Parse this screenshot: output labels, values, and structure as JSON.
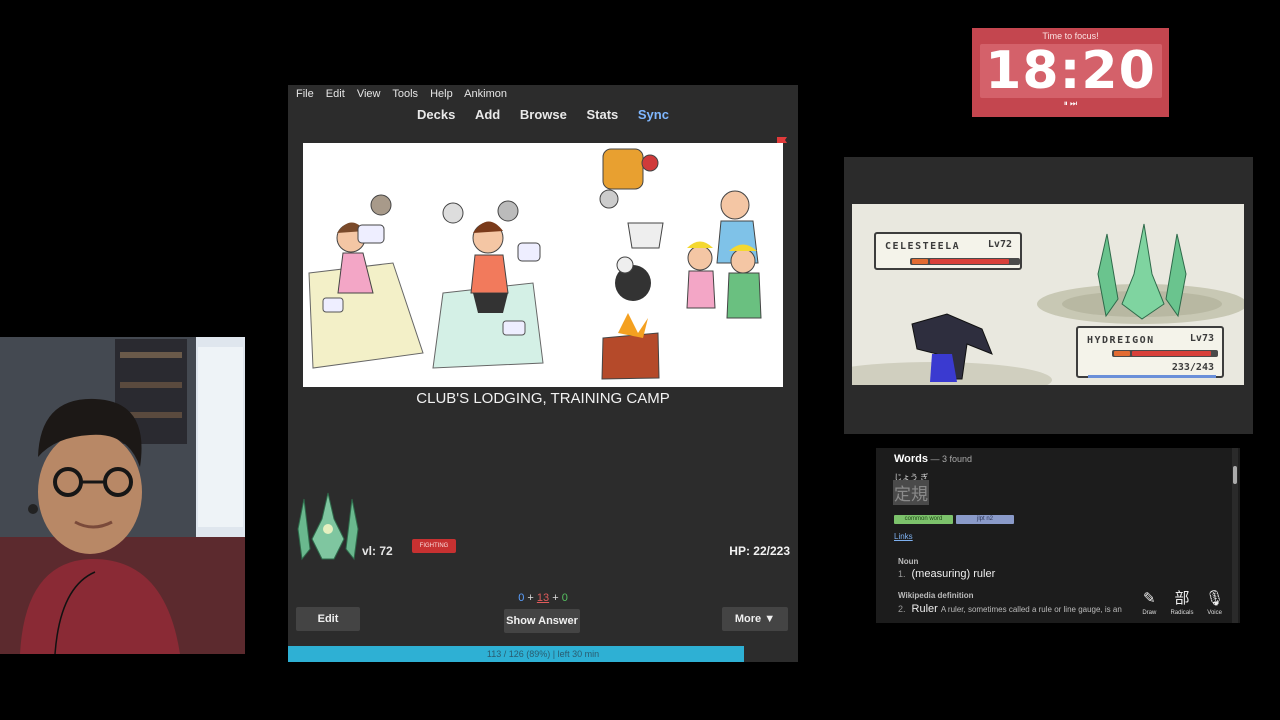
{
  "timer": {
    "label": "Time to focus!",
    "time": "18:20",
    "controls": "⏸ ⏭"
  },
  "anki": {
    "menu": [
      "File",
      "Edit",
      "View",
      "Tools",
      "Help",
      "Ankimon"
    ],
    "toolbar": [
      {
        "label": "Decks",
        "active": false
      },
      {
        "label": "Add",
        "active": false
      },
      {
        "label": "Browse",
        "active": false
      },
      {
        "label": "Stats",
        "active": false
      },
      {
        "label": "Sync",
        "active": true
      }
    ],
    "card_answer": "CLUB'S LODGING, TRAINING CAMP",
    "pokemon": {
      "level": "vl: 72",
      "type": "FIGHTING",
      "hp": "HP: 22/223"
    },
    "counts": {
      "new": "0",
      "learn": "13",
      "due": "0",
      "sep": "+"
    },
    "buttons": {
      "edit": "Edit",
      "show_answer": "Show Answer",
      "more": "More ▼"
    },
    "progress": {
      "text": "113 / 126 (89%) | left 30 min",
      "fraction": 0.89
    },
    "colors": {
      "sync": "#7fb7ff",
      "progress": "#2eb0d4",
      "flag": "#e03a3a"
    }
  },
  "battle": {
    "enemy": {
      "name": "CELESTEELA",
      "level": "Lv72",
      "hp_fraction": 0.92
    },
    "player": {
      "name": "HYDREIGON",
      "level": "Lv73",
      "hp_fraction": 0.96,
      "hp_text": "233/243"
    },
    "hp_label": "HP"
  },
  "dict": {
    "title": "Words",
    "count": " — 3 found",
    "furigana": "じょう ぎ",
    "term": "定規",
    "tags": [
      "common word",
      "jlpt n2"
    ],
    "links": "Links",
    "noun_label": "Noun",
    "sense1_num": "1.",
    "sense1": "(measuring) ruler",
    "wiki_label": "Wikipedia definition",
    "sense2_num": "2.",
    "sense2": "Ruler",
    "sense2_desc": "A ruler, sometimes called a rule or line gauge, is an",
    "tools": [
      {
        "icon": "✎",
        "label": "Draw"
      },
      {
        "icon": "部",
        "label": "Radicals"
      },
      {
        "icon": "🎙",
        "label": "Voice"
      }
    ]
  }
}
